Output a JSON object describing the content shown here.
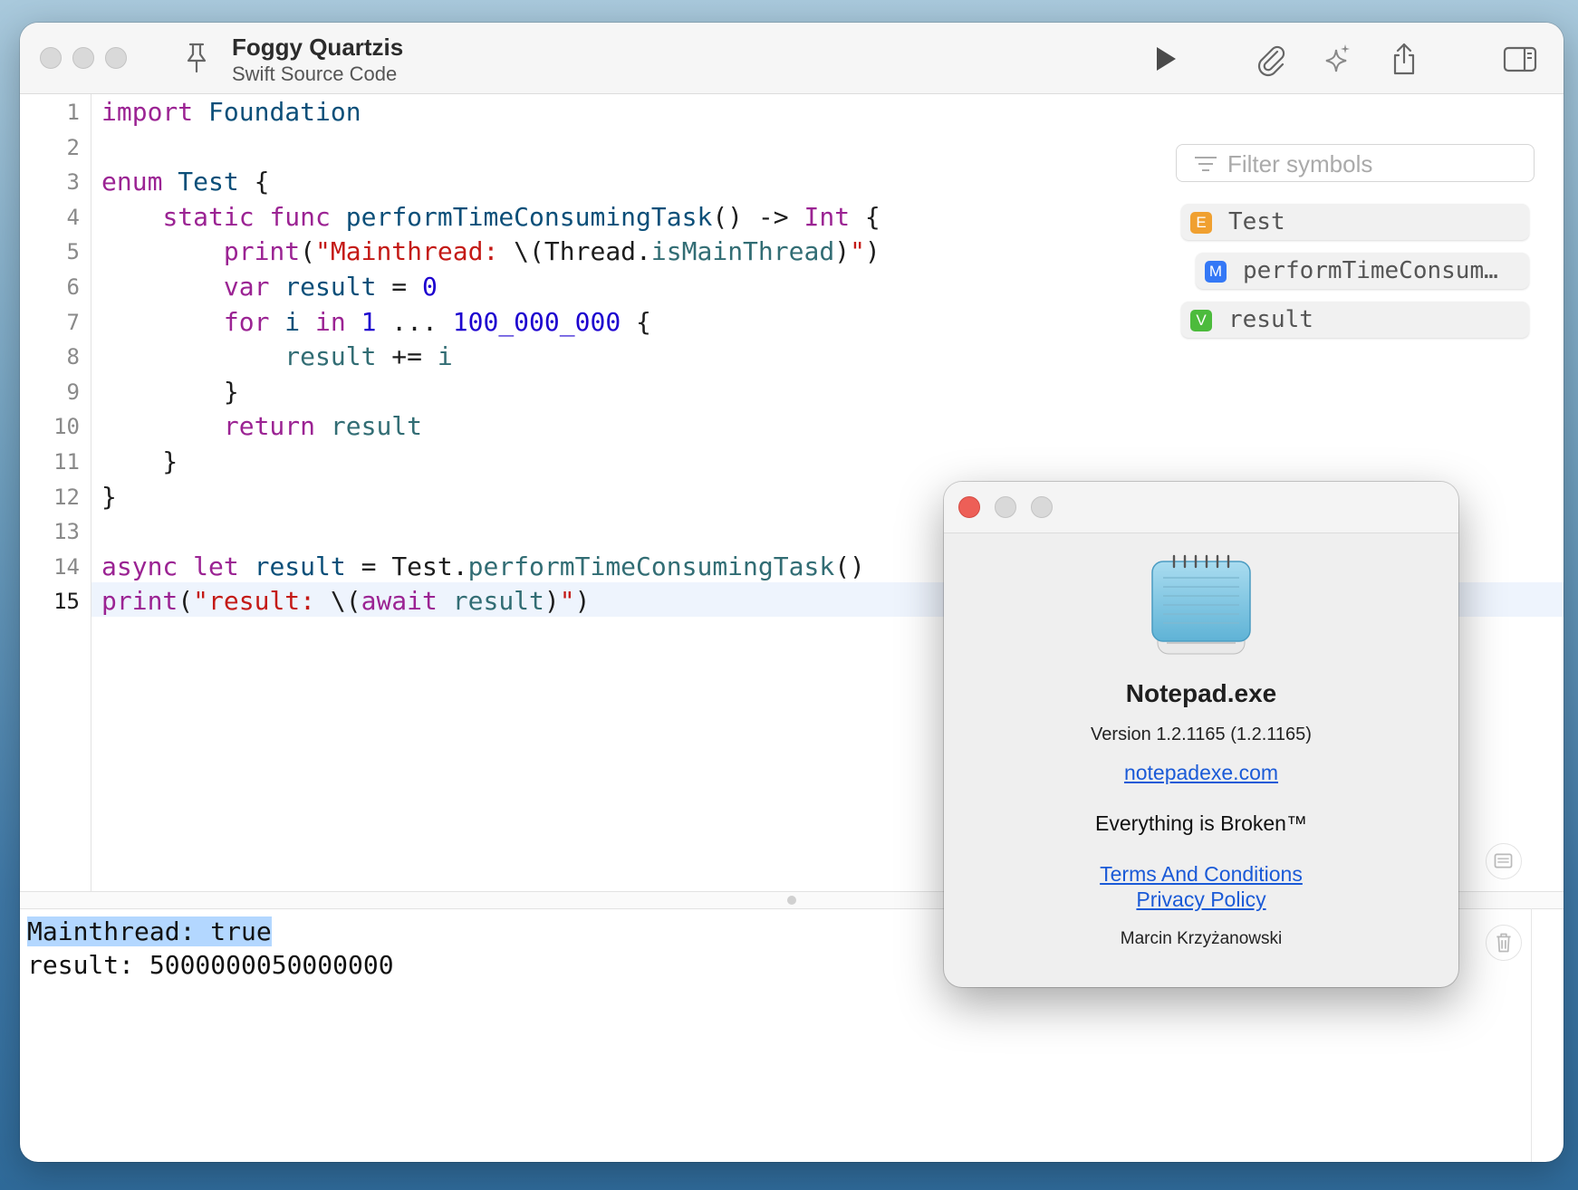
{
  "editor": {
    "title": "Foggy Quartzis",
    "subtitle": "Swift Source Code",
    "current_line": "15",
    "line_numbers": [
      "1",
      "2",
      "3",
      "4",
      "5",
      "6",
      "7",
      "8",
      "9",
      "10",
      "11",
      "12",
      "13",
      "14",
      "15"
    ]
  },
  "code_lines": [
    [
      {
        "t": "import",
        "c": "kw"
      },
      {
        "t": " "
      },
      {
        "t": "Foundation",
        "c": "ty"
      }
    ],
    [],
    [
      {
        "t": "enum",
        "c": "kw"
      },
      {
        "t": " "
      },
      {
        "t": "Test",
        "c": "ty"
      },
      {
        "t": " {"
      }
    ],
    [
      {
        "t": "    "
      },
      {
        "t": "static",
        "c": "kw"
      },
      {
        "t": " "
      },
      {
        "t": "func",
        "c": "kw"
      },
      {
        "t": " "
      },
      {
        "t": "performTimeConsumingTask",
        "c": "ty"
      },
      {
        "t": "() -> "
      },
      {
        "t": "Int",
        "c": "kw"
      },
      {
        "t": " {"
      }
    ],
    [
      {
        "t": "        "
      },
      {
        "t": "print",
        "c": "kw"
      },
      {
        "t": "("
      },
      {
        "t": "\"Mainthread: ",
        "c": "st"
      },
      {
        "t": "\\("
      },
      {
        "t": "Thread.",
        "c": ""
      },
      {
        "t": "isMainThread",
        "c": "fn"
      },
      {
        "t": ")"
      },
      {
        "t": "\"",
        "c": "st"
      },
      {
        "t": ")"
      }
    ],
    [
      {
        "t": "        "
      },
      {
        "t": "var",
        "c": "kw"
      },
      {
        "t": " "
      },
      {
        "t": "result",
        "c": "ty"
      },
      {
        "t": " = "
      },
      {
        "t": "0",
        "c": "nm"
      }
    ],
    [
      {
        "t": "        "
      },
      {
        "t": "for",
        "c": "kw"
      },
      {
        "t": " "
      },
      {
        "t": "i",
        "c": "ty"
      },
      {
        "t": " "
      },
      {
        "t": "in",
        "c": "kw"
      },
      {
        "t": " "
      },
      {
        "t": "1",
        "c": "nm"
      },
      {
        "t": " ... "
      },
      {
        "t": "100_000_000",
        "c": "nm"
      },
      {
        "t": " {"
      }
    ],
    [
      {
        "t": "            "
      },
      {
        "t": "result",
        "c": "fn"
      },
      {
        "t": " += "
      },
      {
        "t": "i",
        "c": "fn"
      }
    ],
    [
      {
        "t": "        }"
      }
    ],
    [
      {
        "t": "        "
      },
      {
        "t": "return",
        "c": "kw"
      },
      {
        "t": " "
      },
      {
        "t": "result",
        "c": "fn"
      }
    ],
    [
      {
        "t": "    }"
      }
    ],
    [
      {
        "t": "}"
      }
    ],
    [],
    [
      {
        "t": "async",
        "c": "kw"
      },
      {
        "t": " "
      },
      {
        "t": "let",
        "c": "kw"
      },
      {
        "t": " "
      },
      {
        "t": "result",
        "c": "ty"
      },
      {
        "t": " = Test."
      },
      {
        "t": "performTimeConsumingTask",
        "c": "fn"
      },
      {
        "t": "()"
      }
    ],
    [
      {
        "t": "print",
        "c": "kw"
      },
      {
        "t": "("
      },
      {
        "t": "\"result: ",
        "c": "st"
      },
      {
        "t": "\\("
      },
      {
        "t": "await",
        "c": "kw"
      },
      {
        "t": " "
      },
      {
        "t": "result",
        "c": "fn"
      },
      {
        "t": ")"
      },
      {
        "t": "\"",
        "c": "st"
      },
      {
        "t": ")"
      }
    ]
  ],
  "symbols": {
    "filter_placeholder": "Filter symbols",
    "items": [
      {
        "badge": "E",
        "label": "Test",
        "color": "#f0a030"
      },
      {
        "badge": "M",
        "label": "performTimeConsum…",
        "color": "#3478f6"
      },
      {
        "badge": "V",
        "label": "result",
        "color": "#4cbb3c"
      }
    ]
  },
  "console": {
    "lines": [
      "Mainthread: true",
      "result: 5000000050000000"
    ]
  },
  "about": {
    "app_name": "Notepad.exe",
    "version": "Version 1.2.1165 (1.2.1165)",
    "website": "notepadexe.com",
    "tagline": "Everything is Broken™",
    "terms": "Terms And Conditions",
    "privacy": "Privacy Policy",
    "author": "Marcin Krzyżanowski"
  },
  "icons": {
    "run": "play-icon",
    "attach": "paperclip-icon",
    "ai": "sparkle-icon",
    "share": "share-icon",
    "sidebar": "sidebar-icon",
    "pin": "pin-icon"
  },
  "colors": {
    "close_red": "#ed5f57",
    "current_line": "#eef4fd",
    "selection": "#b3d7ff",
    "link": "#1a5ad7"
  }
}
